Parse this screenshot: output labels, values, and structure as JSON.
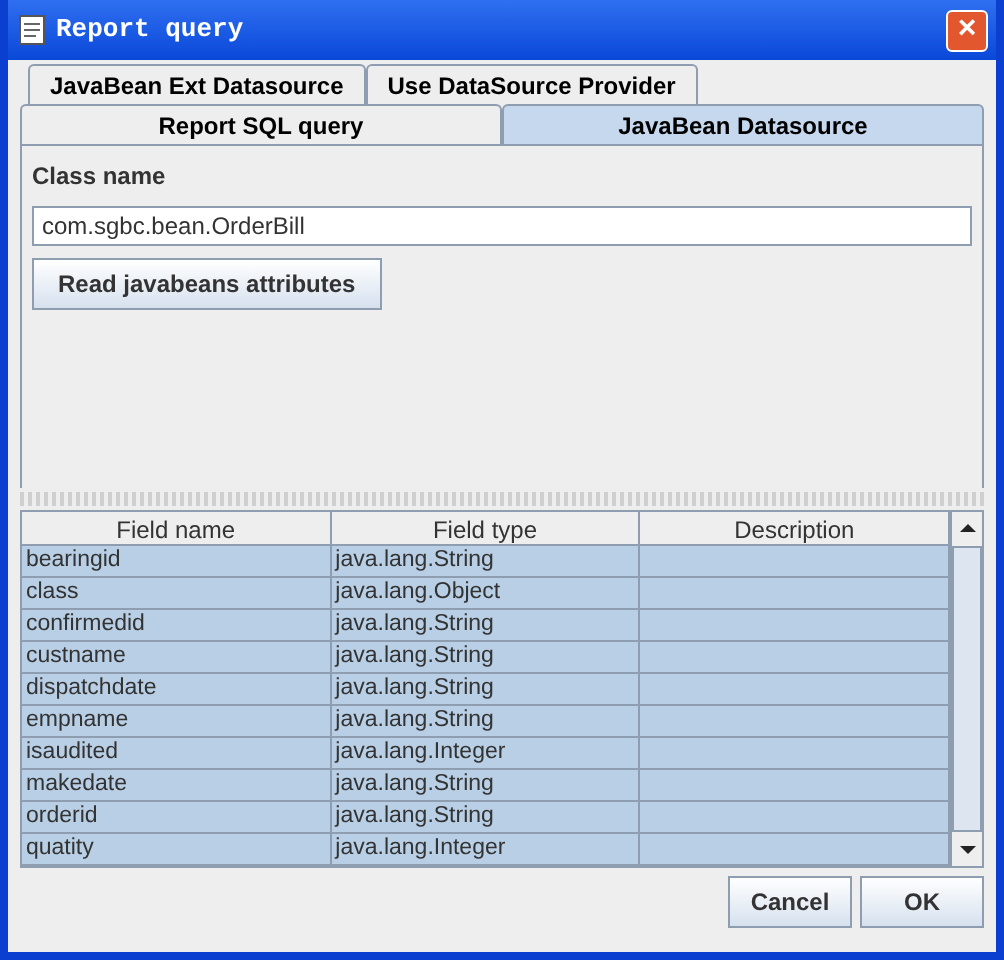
{
  "window": {
    "title": "Report query",
    "close": "×"
  },
  "tab_rows": [
    [
      {
        "label": "JavaBean Ext Datasource",
        "selected": false
      },
      {
        "label": "Use DataSource Provider",
        "selected": false
      }
    ],
    [
      {
        "label": "Report SQL query",
        "selected": false
      },
      {
        "label": "JavaBean Datasource",
        "selected": true
      }
    ]
  ],
  "class_name": {
    "label": "Class name",
    "value": "com.sgbc.bean.OrderBill"
  },
  "read_button": "Read javabeans attributes",
  "table": {
    "columns": [
      "Field name",
      "Field type",
      "Description"
    ],
    "rows": [
      {
        "cells": [
          "bearingid",
          "java.lang.String"
        ],
        "selected": true
      },
      {
        "cells": [
          "class",
          "java.lang.Object"
        ],
        "selected": true
      },
      {
        "cells": [
          "confirmedid",
          "java.lang.String"
        ],
        "selected": true
      },
      {
        "cells": [
          "custname",
          "java.lang.String"
        ],
        "selected": true
      },
      {
        "cells": [
          "dispatchdate",
          "java.lang.String"
        ],
        "selected": true
      },
      {
        "cells": [
          "empname",
          "java.lang.String"
        ],
        "selected": true
      },
      {
        "cells": [
          "isaudited",
          "java.lang.Integer"
        ],
        "selected": true
      },
      {
        "cells": [
          "makedate",
          "java.lang.String"
        ],
        "selected": true
      },
      {
        "cells": [
          "orderid",
          "java.lang.String"
        ],
        "selected": true
      },
      {
        "cells": [
          "quatity",
          "java.lang.Integer"
        ],
        "selected": true
      }
    ]
  },
  "buttons": [
    "Cancel",
    "OK"
  ]
}
